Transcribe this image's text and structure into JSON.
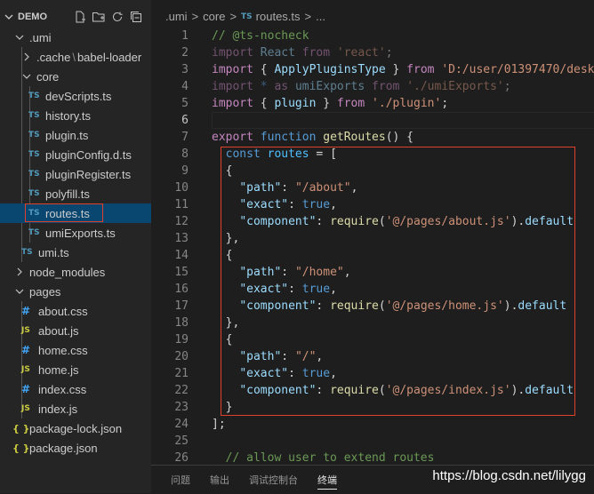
{
  "sidebar": {
    "title": "DEMO",
    "tree": [
      {
        "label": ".umi",
        "kind": "folder-open"
      },
      {
        "label": ".cache",
        "kind": "folder-closed",
        "suffix": "babel-loader"
      },
      {
        "label": "core",
        "kind": "folder-open"
      },
      {
        "label": "devScripts.ts",
        "kind": "ts"
      },
      {
        "label": "history.ts",
        "kind": "ts"
      },
      {
        "label": "plugin.ts",
        "kind": "ts"
      },
      {
        "label": "pluginConfig.d.ts",
        "kind": "ts"
      },
      {
        "label": "pluginRegister.ts",
        "kind": "ts"
      },
      {
        "label": "polyfill.ts",
        "kind": "ts"
      },
      {
        "label": "routes.ts",
        "kind": "ts",
        "selected": true
      },
      {
        "label": "umiExports.ts",
        "kind": "ts"
      },
      {
        "label": "umi.ts",
        "kind": "ts"
      },
      {
        "label": "node_modules",
        "kind": "folder-closed"
      },
      {
        "label": "pages",
        "kind": "folder-open"
      },
      {
        "label": "about.css",
        "kind": "css"
      },
      {
        "label": "about.js",
        "kind": "js"
      },
      {
        "label": "home.css",
        "kind": "css"
      },
      {
        "label": "home.js",
        "kind": "js"
      },
      {
        "label": "index.css",
        "kind": "css"
      },
      {
        "label": "index.js",
        "kind": "js"
      },
      {
        "label": "package-lock.json",
        "kind": "json"
      },
      {
        "label": "package.json",
        "kind": "json"
      }
    ]
  },
  "breadcrumb": {
    "items": [
      ".umi",
      "core",
      "routes.ts",
      "..."
    ],
    "file_badge": "TS"
  },
  "file_badges": {
    "ts": "TS",
    "js": "JS",
    "css": "#",
    "json": "{ }"
  },
  "editor": {
    "line_numbers": [
      "1",
      "2",
      "3",
      "4",
      "5",
      "6",
      "7",
      "8",
      "9",
      "10",
      "11",
      "12",
      "13",
      "14",
      "15",
      "16",
      "17",
      "18",
      "19",
      "20",
      "21",
      "22",
      "23",
      "24",
      "25",
      "26"
    ],
    "active_line": 6
  },
  "panel": {
    "tabs": [
      "问题",
      "输出",
      "调试控制台",
      "终端"
    ],
    "active_tab": "终端"
  },
  "watermark": "https://blog.csdn.net/lilygg",
  "colors": {
    "accent_box": "#e0412b",
    "selection": "#094771"
  }
}
